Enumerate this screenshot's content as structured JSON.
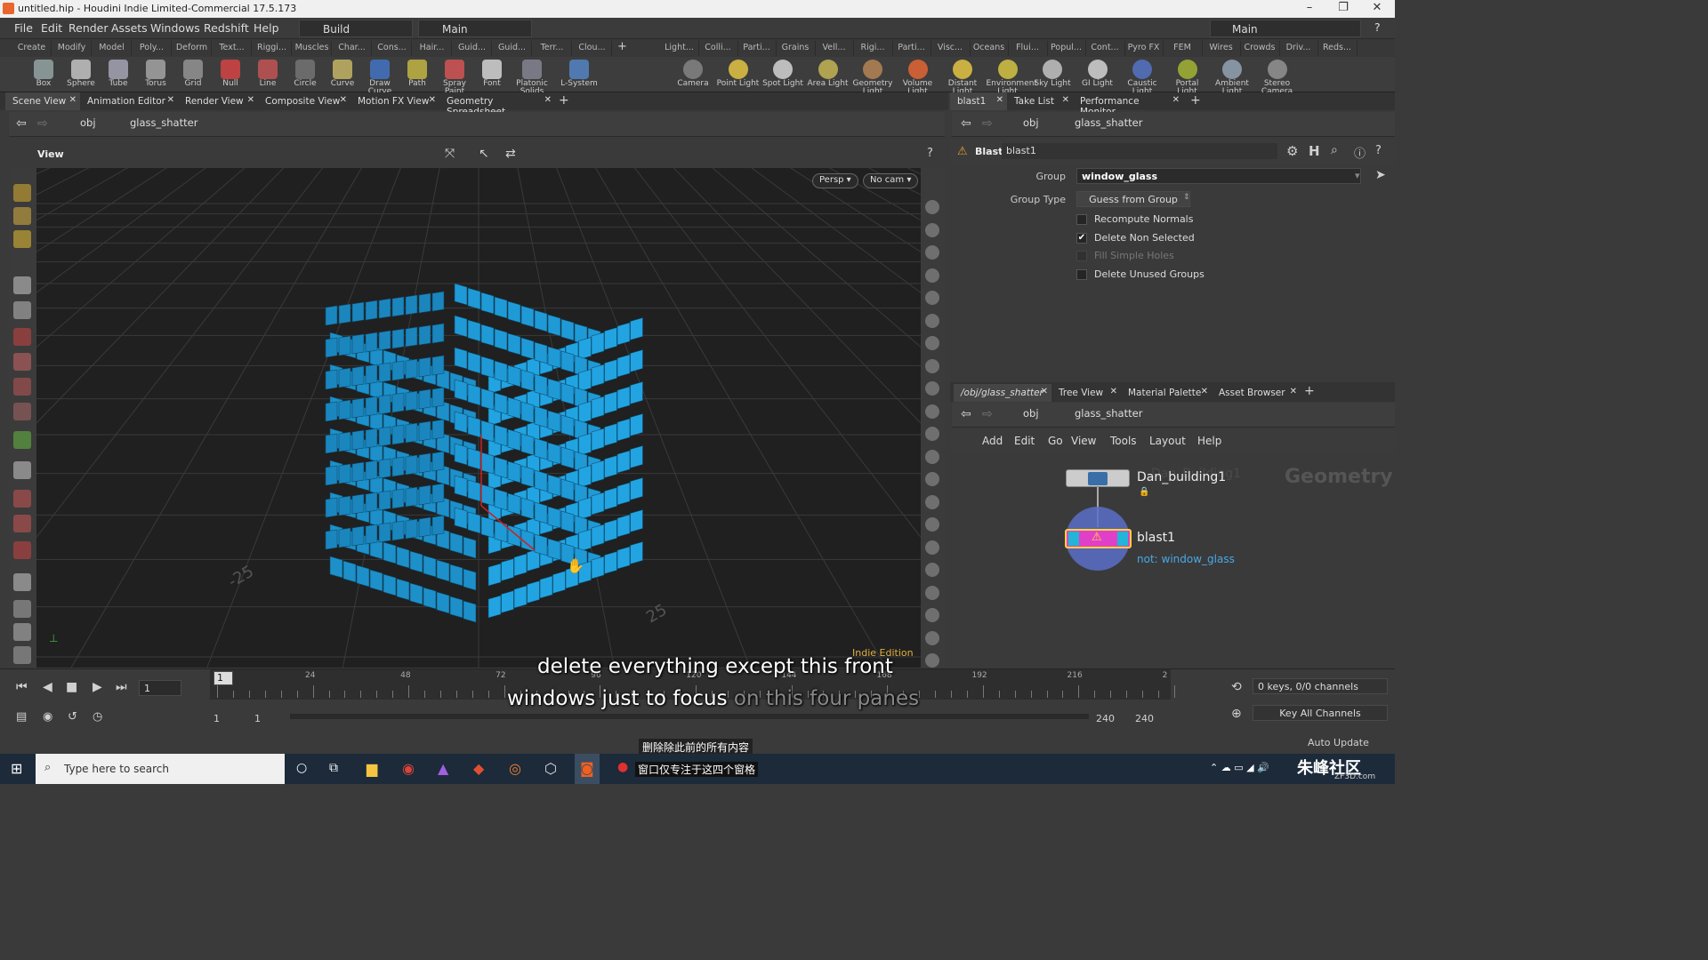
{
  "window": {
    "title": "untitled.hip - Houdini Indie Limited-Commercial 17.5.173"
  },
  "menu": [
    "File",
    "Edit",
    "Render",
    "Assets",
    "Windows",
    "Redshift",
    "Help"
  ],
  "desktop_left": "Build",
  "desktop_right": "Main",
  "desktop_far": "Main",
  "shelf_tabs_left": [
    "Create",
    "Modify",
    "Model",
    "Poly...",
    "Deform",
    "Text...",
    "Riggi...",
    "Muscles",
    "Char...",
    "Cons...",
    "Hair...",
    "Guid...",
    "Guid...",
    "Terr...",
    "Clou..."
  ],
  "shelf_tabs_right": [
    "Light...",
    "Colli...",
    "Parti...",
    "Grains",
    "Vell...",
    "Rigi...",
    "Parti...",
    "Visc...",
    "Oceans",
    "Flui...",
    "Popul...",
    "Cont...",
    "Pyro FX",
    "FEM",
    "Wires",
    "Crowds",
    "Driv...",
    "Reds..."
  ],
  "tools_left": [
    "Box",
    "Sphere",
    "Tube",
    "Torus",
    "Grid",
    "Null",
    "Line",
    "Circle",
    "Curve",
    "Draw Curve",
    "Path",
    "Spray Paint",
    "Font",
    "Platonic Solids",
    "L-System"
  ],
  "tools_right": [
    "Camera",
    "Point Light",
    "Spot Light",
    "Area Light",
    "Geometry Light",
    "Volume Light",
    "Distant Light",
    "Environment Light",
    "Sky Light",
    "GI Light",
    "Caustic Light",
    "Portal Light",
    "Ambient Light",
    "Stereo Camera"
  ],
  "left_pane_tabs": [
    "Scene View",
    "Animation Editor",
    "Render View",
    "Composite View",
    "Motion FX View",
    "Geometry Spreadsheet"
  ],
  "right_pane_tabs": [
    "blast1",
    "Take List",
    "Performance Monitor"
  ],
  "path": {
    "context": "obj",
    "node": "glass_shatter"
  },
  "view": {
    "label": "View",
    "persp": "Persp",
    "cam": "No cam",
    "edition": "Indie Edition",
    "grid_labels": [
      "-25",
      "25"
    ]
  },
  "params": {
    "node_type": "Blast",
    "node_name": "blast1",
    "group_label": "Group",
    "group_value": "window_glass",
    "group_type_label": "Group Type",
    "group_type_value": "Guess from Group",
    "options": [
      {
        "label": "Recompute Normals",
        "checked": false,
        "enabled": true
      },
      {
        "label": "Delete Non Selected",
        "checked": true,
        "enabled": true
      },
      {
        "label": "Fill Simple Holes",
        "checked": false,
        "enabled": false
      },
      {
        "label": "Delete Unused Groups",
        "checked": false,
        "enabled": true
      }
    ]
  },
  "net_tabs": [
    "/obj/glass_shatter",
    "Tree View",
    "Material Palette",
    "Asset Browser"
  ],
  "net_menu": [
    "Add",
    "Edit",
    "Go",
    "View",
    "Tools",
    "Layout",
    "Help"
  ],
  "network": {
    "watermark": "Geometry",
    "ghost_label": "Dan_Building1",
    "nodes": [
      {
        "name": "Dan_building1",
        "sub": ""
      },
      {
        "name": "blast1",
        "sub": "not: window_glass"
      }
    ]
  },
  "timeline": {
    "current_frame": "1",
    "marker": "1",
    "ticks": [
      "24",
      "48",
      "72",
      "96",
      "120",
      "144",
      "168",
      "192",
      "216",
      "2"
    ],
    "start": "1",
    "start2": "1",
    "end": "240",
    "end2": "240",
    "keys": "0 keys, 0/0 channels",
    "key_all": "Key All Channels",
    "auto_update": "Auto Update"
  },
  "subtitles": {
    "line1": "delete everything except this front",
    "line2a": "windows just to focus",
    "line2b": "on this four panes",
    "cn1": "删除除此前的所有内容",
    "cn2": "窗口仅专注于这四个窗格"
  },
  "taskbar": {
    "search": "Type here to search",
    "watermark": "朱峰社区",
    "watermark_sub": "ZF3D.com"
  },
  "colors": {
    "accent": "#1f9ad6",
    "node_pink": "#e040c8",
    "bg": "#3a3a3a"
  }
}
